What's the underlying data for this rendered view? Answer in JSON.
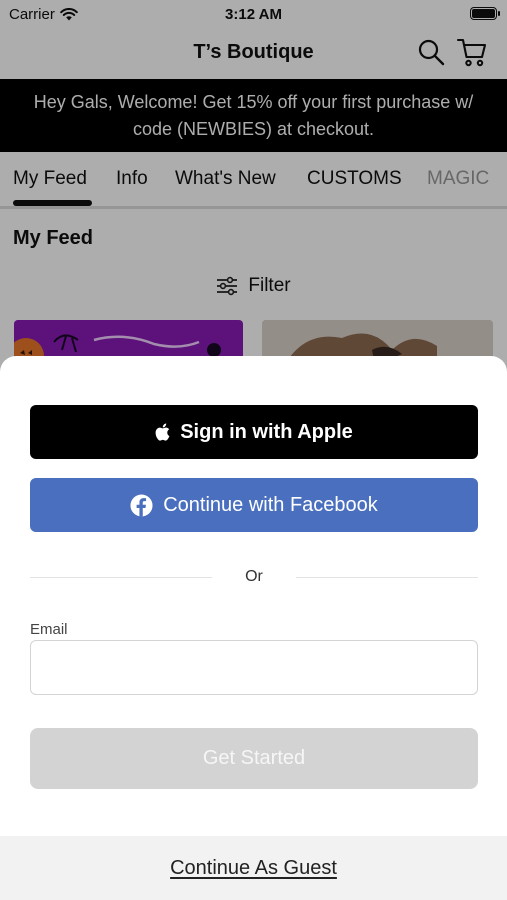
{
  "status_bar": {
    "carrier": "Carrier",
    "time": "3:12 AM"
  },
  "nav": {
    "title": "T’s Boutique",
    "search_icon": "search-icon",
    "cart_icon": "cart-icon"
  },
  "promo": {
    "line1": "Hey Gals, Welcome! Get 15% off your first purchase w/",
    "line2": "code (NEWBIES) at checkout."
  },
  "tabs": [
    {
      "label": "My Feed",
      "active": true
    },
    {
      "label": "Info",
      "active": false
    },
    {
      "label": "What's New",
      "active": false
    },
    {
      "label": "CUSTOMS",
      "active": false
    },
    {
      "label": "MAGIC",
      "active": false
    }
  ],
  "feed": {
    "title": "My Feed",
    "filter_label": "Filter"
  },
  "sheet": {
    "apple_label": "Sign in with Apple",
    "facebook_label": "Continue with Facebook",
    "divider_label": "Or",
    "email_label": "Email",
    "email_value": "",
    "email_placeholder": "",
    "start_label": "Get Started",
    "guest_label": "Continue As Guest"
  },
  "colors": {
    "facebook": "#4a6fbf",
    "apple": "#000000",
    "disabled": "#d3d3d3",
    "promo_bg": "#000000"
  }
}
